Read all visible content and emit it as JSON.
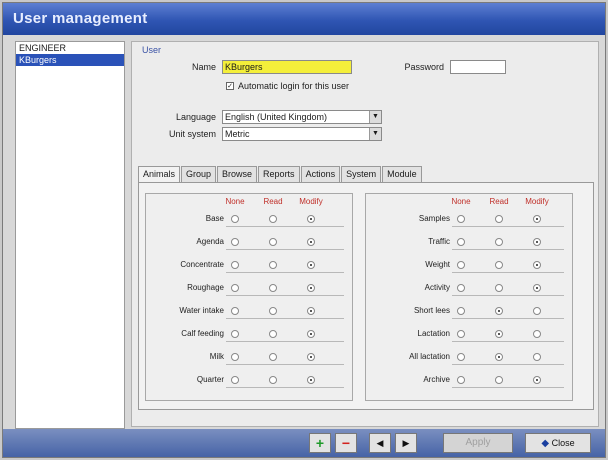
{
  "window": {
    "title": "User management"
  },
  "users": [
    {
      "name": "ENGINEER",
      "selected": false
    },
    {
      "name": "KBurgers",
      "selected": true
    }
  ],
  "form": {
    "group_label": "User",
    "name_label": "Name",
    "name_value": "KBurgers",
    "password_label": "Password",
    "password_value": "",
    "auto_login_label": "Automatic login for this user",
    "auto_login_checked": true,
    "language_label": "Language",
    "language_value": "English (United Kingdom)",
    "unit_label": "Unit system",
    "unit_value": "Metric"
  },
  "tabs": [
    "Animals",
    "Group",
    "Browse",
    "Reports",
    "Actions",
    "System",
    "Module"
  ],
  "active_tab": 0,
  "permissions": {
    "columns": [
      "None",
      "Read",
      "Modify"
    ],
    "left": [
      {
        "label": "Base",
        "value": "Modify"
      },
      {
        "label": "Agenda",
        "value": "Modify"
      },
      {
        "label": "Concentrate",
        "value": "Modify"
      },
      {
        "label": "Roughage",
        "value": "Modify"
      },
      {
        "label": "Water intake",
        "value": "Modify"
      },
      {
        "label": "Calf feeding",
        "value": "Modify"
      },
      {
        "label": "Milk",
        "value": "Modify"
      },
      {
        "label": "Quarter",
        "value": "Modify"
      }
    ],
    "right": [
      {
        "label": "Samples",
        "value": "Modify"
      },
      {
        "label": "Traffic",
        "value": "Modify"
      },
      {
        "label": "Weight",
        "value": "Modify"
      },
      {
        "label": "Activity",
        "value": "Modify"
      },
      {
        "label": "Short lees",
        "value": "Read"
      },
      {
        "label": "Lactation",
        "value": "Read"
      },
      {
        "label": "All lactation",
        "value": "Read"
      },
      {
        "label": "Archive",
        "value": "Modify"
      }
    ]
  },
  "buttons": {
    "add_icon": "plus-icon",
    "delete_icon": "minus-icon",
    "prev_icon": "arrow-left-icon",
    "next_icon": "arrow-right-icon",
    "apply_label": "Apply",
    "close_label": "Close",
    "close_icon": "diamond-icon"
  },
  "colors": {
    "titlebar": "#2f55b3",
    "selection": "#2a52b8",
    "name_highlight": "#f4ef3a",
    "column_header": "#c0302a",
    "add_button": "#1f9a2a",
    "delete_button": "#d3221e"
  }
}
